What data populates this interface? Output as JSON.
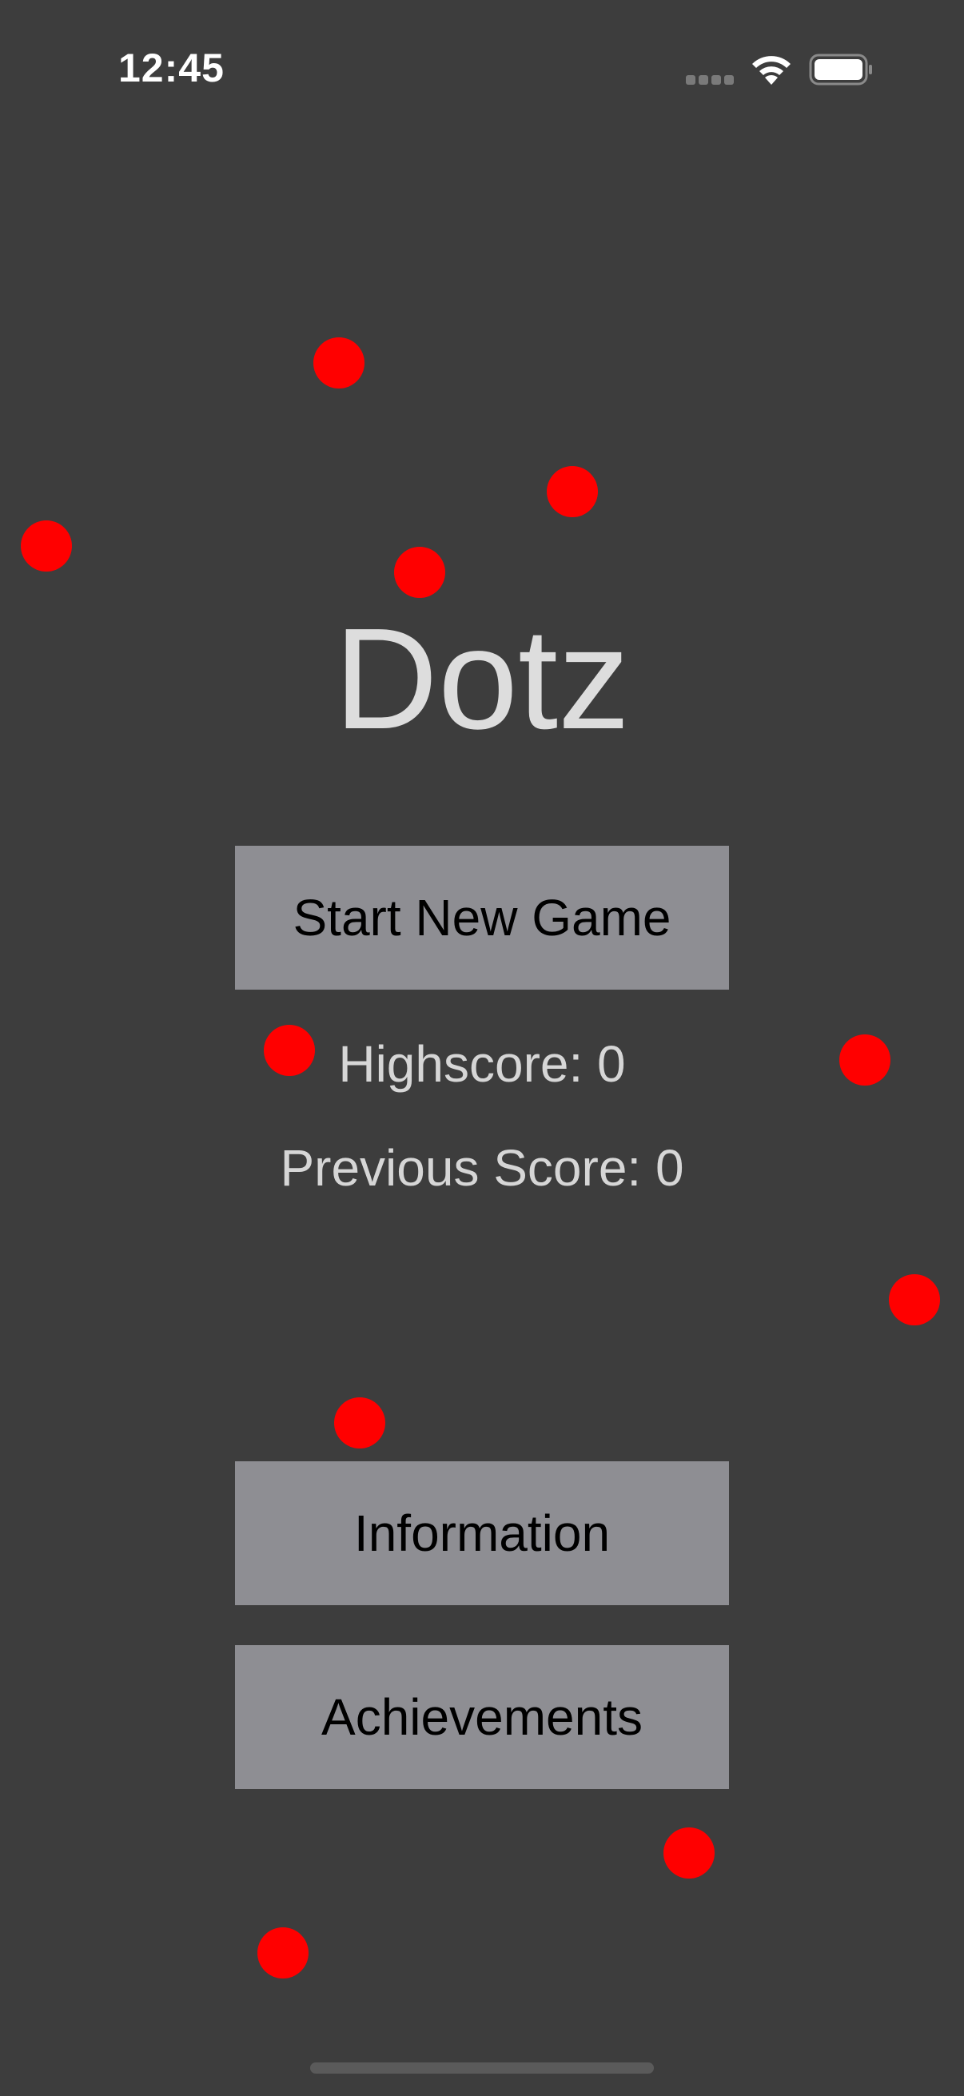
{
  "status_bar": {
    "time": "12:45",
    "icons": [
      "cellular-signal-icon",
      "wifi-icon",
      "battery-icon"
    ]
  },
  "app": {
    "title": "Dotz"
  },
  "menu": {
    "start_button_label": "Start New Game",
    "highscore_label": "Highscore: 0",
    "previous_score_label": "Previous Score: 0",
    "information_button_label": "Information",
    "achievements_button_label": "Achievements"
  },
  "scores": {
    "highscore": 0,
    "previous_score": 0
  },
  "colors": {
    "background": "#3d3d3d",
    "dot": "#ff0000",
    "button": "#8e8e93",
    "title_text": "#dddddd"
  }
}
